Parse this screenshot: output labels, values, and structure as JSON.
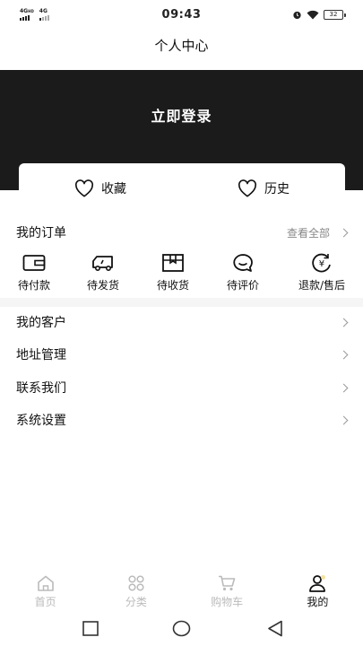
{
  "status": {
    "signal1": "4G",
    "signal1_sup": "HD",
    "signal2": "4G",
    "time": "09:43",
    "battery": "32"
  },
  "header": {
    "title": "个人中心"
  },
  "hero": {
    "login_label": "立即登录"
  },
  "quick": {
    "favorites": "收藏",
    "history": "历史"
  },
  "orders": {
    "title": "我的订单",
    "view_all": "查看全部",
    "items": [
      {
        "label": "待付款",
        "icon": "wallet-icon"
      },
      {
        "label": "待发货",
        "icon": "truck-icon"
      },
      {
        "label": "待收货",
        "icon": "box-icon"
      },
      {
        "label": "待评价",
        "icon": "chat-icon"
      },
      {
        "label": "退款/售后",
        "icon": "refund-icon"
      }
    ]
  },
  "menu": [
    {
      "label": "我的客户"
    },
    {
      "label": "地址管理"
    },
    {
      "label": "联系我们"
    },
    {
      "label": "系统设置"
    }
  ],
  "tabs": [
    {
      "label": "首页",
      "icon": "home-icon"
    },
    {
      "label": "分类",
      "icon": "grid-icon"
    },
    {
      "label": "购物车",
      "icon": "cart-icon"
    },
    {
      "label": "我的",
      "icon": "user-icon",
      "active": true
    }
  ],
  "colors": {
    "hero_bg": "#1b1b1b",
    "tab_inactive": "#bbbbbb",
    "tab_active": "#111111"
  }
}
